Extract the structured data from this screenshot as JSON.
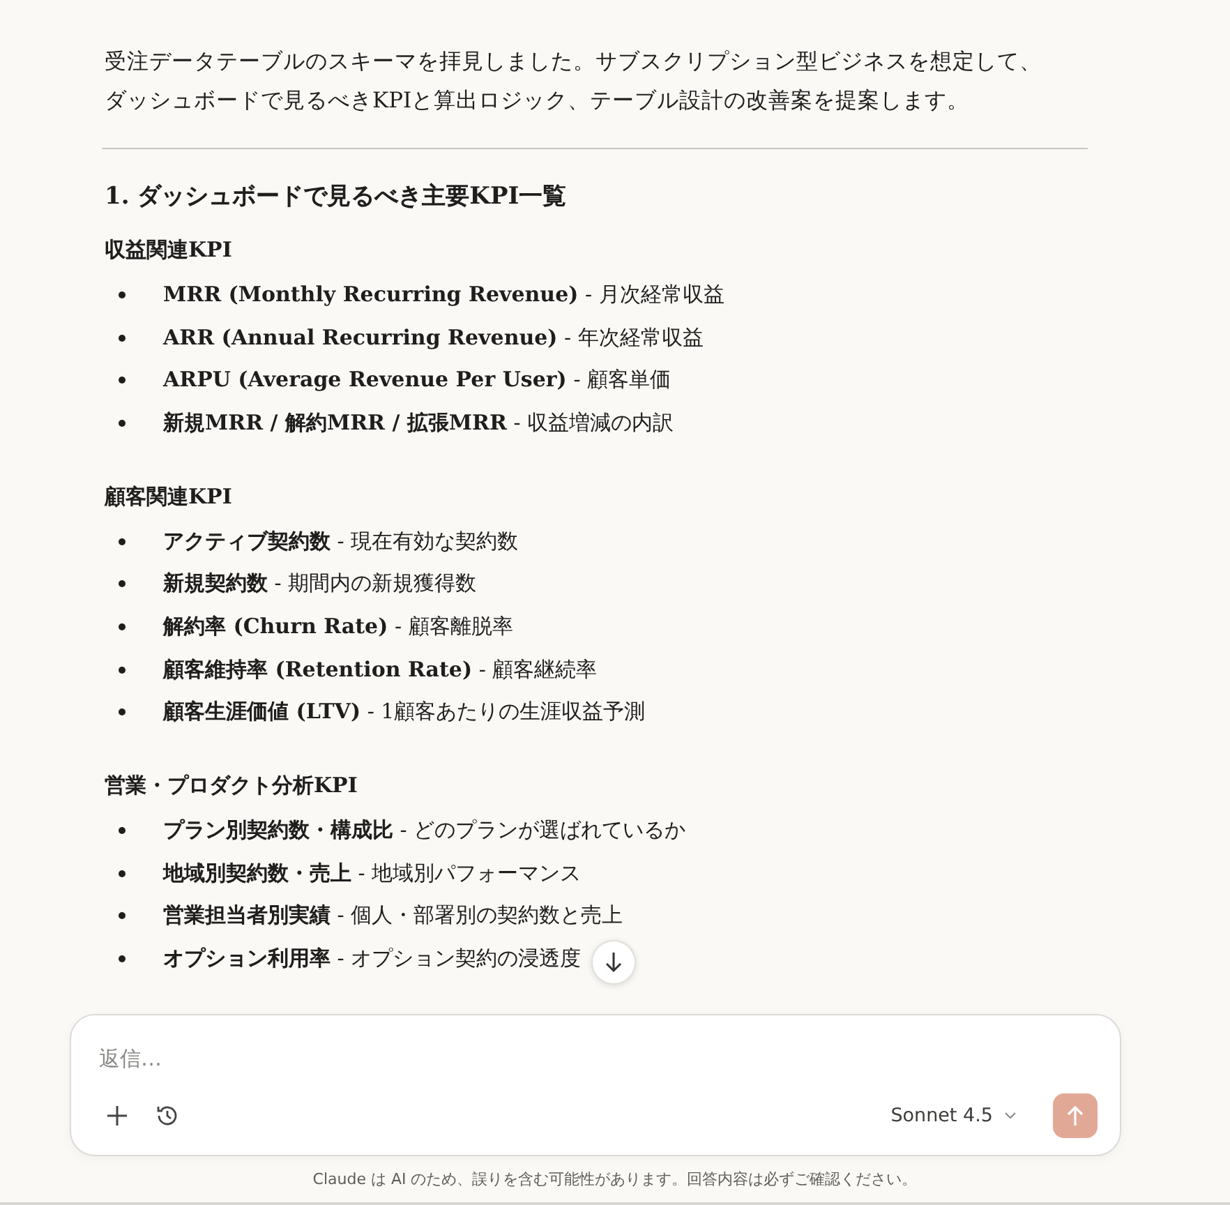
{
  "intro": "受注データテーブルのスキーマを拝見しました。サブスクリプション型ビジネスを想定して、ダッシュボードで見るべきKPIと算出ロジック、テーブル設計の改善案を提案します。",
  "heading": "1. ダッシュボードで見るべき主要KPI一覧",
  "sections": [
    {
      "title": "収益関連KPI",
      "items": [
        "**MRR (Monthly Recurring Revenue)** - 月次経常収益",
        "**ARR (Annual Recurring Revenue)** - 年次経常収益",
        "**ARPU (Average Revenue Per User)** - 顧客単価",
        "**新規MRR / 解約MRR / 拡張MRR** - 収益増減の内訳"
      ]
    },
    {
      "title": "顧客関連KPI",
      "items": [
        "**アクティブ契約数** - 現在有効な契約数",
        "**新規契約数** - 期間内の新規獲得数",
        "**解約率 (Churn Rate)** - 顧客離脱率",
        "**顧客維持率 (Retention Rate)** - 顧客継続率",
        "**顧客生涯価値 (LTV)** - 1顧客あたりの生涯収益予測"
      ]
    },
    {
      "title": "営業・プロダクト分析KPI",
      "items": [
        "**プラン別契約数・構成比** - どのプランが選ばれているか",
        "**地域別契約数・売上** - 地域別パフォーマンス",
        "**営業担当者別実績** - 個人・部署別の契約数と売上",
        "**オプション利用率** - オプション契約の浸透度"
      ]
    }
  ],
  "composer": {
    "placeholder": "返信…",
    "model": "Sonnet 4.5"
  },
  "disclaimer": "Claude は AI のため、誤りを含む可能性があります。回答内容は必ずご確認ください。"
}
